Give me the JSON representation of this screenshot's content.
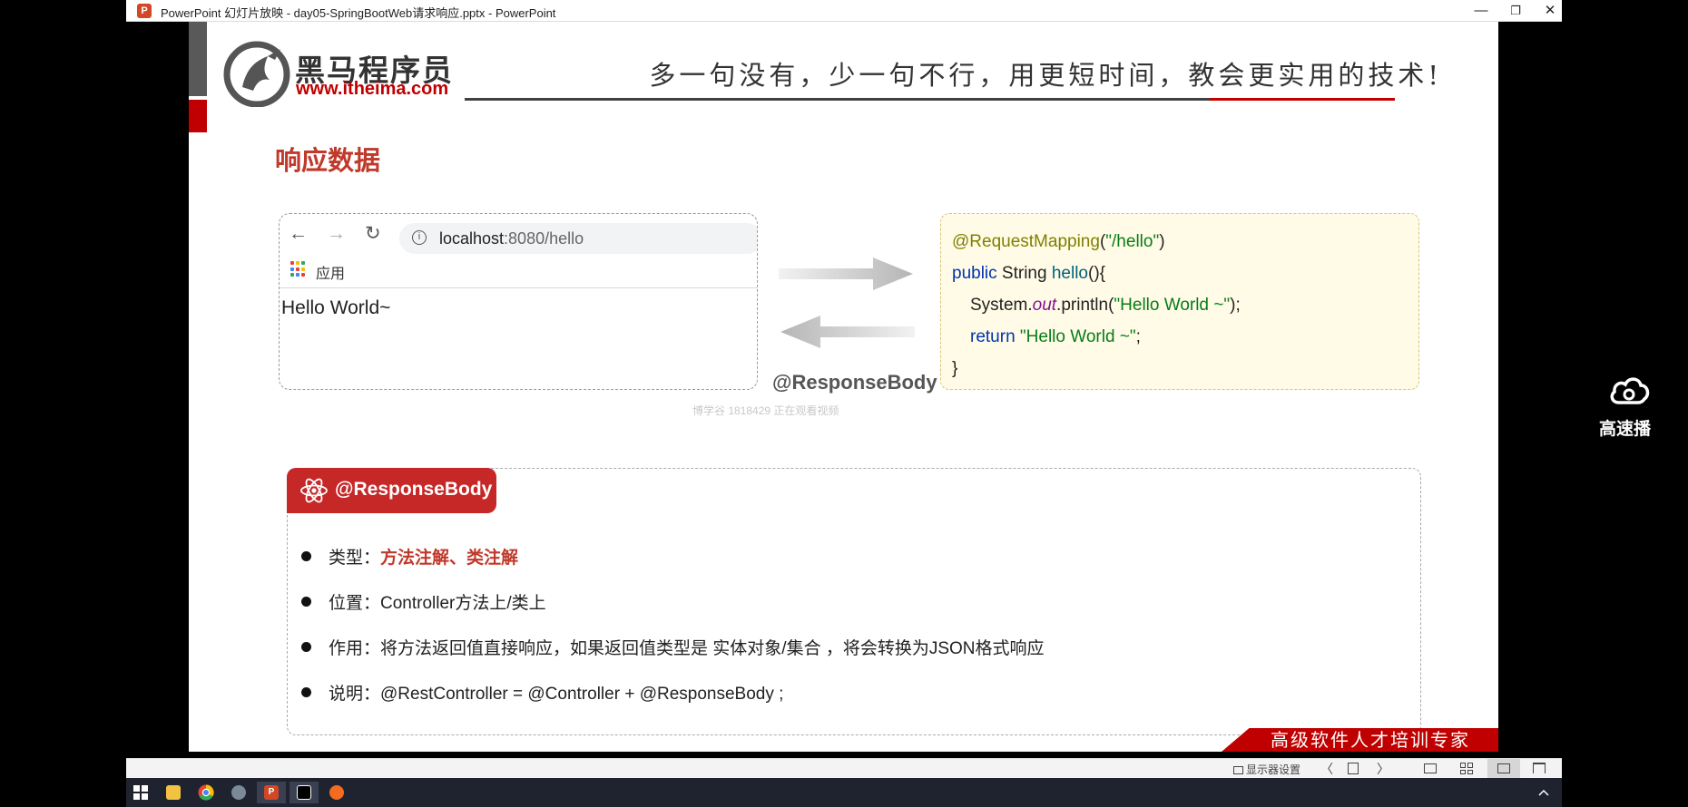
{
  "window": {
    "title": "PowerPoint 幻灯片放映  -  day05-SpringBootWeb请求响应.pptx - PowerPoint",
    "app_icon_letter": "P",
    "minimize_glyph": "—",
    "restore_glyph": "❐",
    "close_glyph": "✕"
  },
  "header": {
    "brand_name": "黑马程序员",
    "brand_url": "www.itheima.com",
    "slogan": "多一句没有，少一句不行，用更短时间，教会更实用的技术!"
  },
  "slide": {
    "title": "响应数据",
    "browser": {
      "back_glyph": "←",
      "forward_glyph": "→",
      "reload_glyph": "↻",
      "info_glyph": "i",
      "url_host": "localhost",
      "url_rest": ":8080/hello",
      "apps_label": "应用",
      "content": "Hello World~"
    },
    "arrow_label": "@ResponseBody",
    "code": {
      "line1_anno": "@RequestMapping",
      "line1_open": "(",
      "line1_str": "\"/hello\"",
      "line1_close": ")",
      "line2_kw": "public",
      "line2_type": " String ",
      "line2_fn": "hello",
      "line2_rest": "(){",
      "line3_pre": "System.",
      "line3_static": "out",
      "line3_mid": ".println(",
      "line3_str": "\"Hello World ~\"",
      "line3_end": ");",
      "line4_kw": "return",
      "line4_sp": " ",
      "line4_str": "\"Hello World ~\"",
      "line4_end": ";",
      "line5": "}"
    },
    "watermark": "博学谷 1818429 正在观看视频",
    "panel": {
      "badge": "@ResponseBody",
      "items": [
        {
          "label": "类型：",
          "value": "方法注解、类注解"
        },
        {
          "label": "位置：",
          "value": "Controller方法上/类上"
        },
        {
          "label": "作用：",
          "value": "将方法返回值直接响应，如果返回值类型是 实体对象/集合 ，将会转换为JSON格式响应"
        },
        {
          "label": "说明：",
          "value": "@RestController = @Controller + @ResponseBody ;"
        }
      ]
    },
    "footer": "高级软件人才培训专家"
  },
  "overlay": {
    "fast_play_label": "高速播"
  },
  "statusbar": {
    "display_settings": "显示器设置",
    "prev_glyph": "〈",
    "next_glyph": "〉"
  },
  "colors": {
    "accent_red": "#c00000",
    "title_red": "#c0392b",
    "code_bg": "#fffbe6"
  }
}
